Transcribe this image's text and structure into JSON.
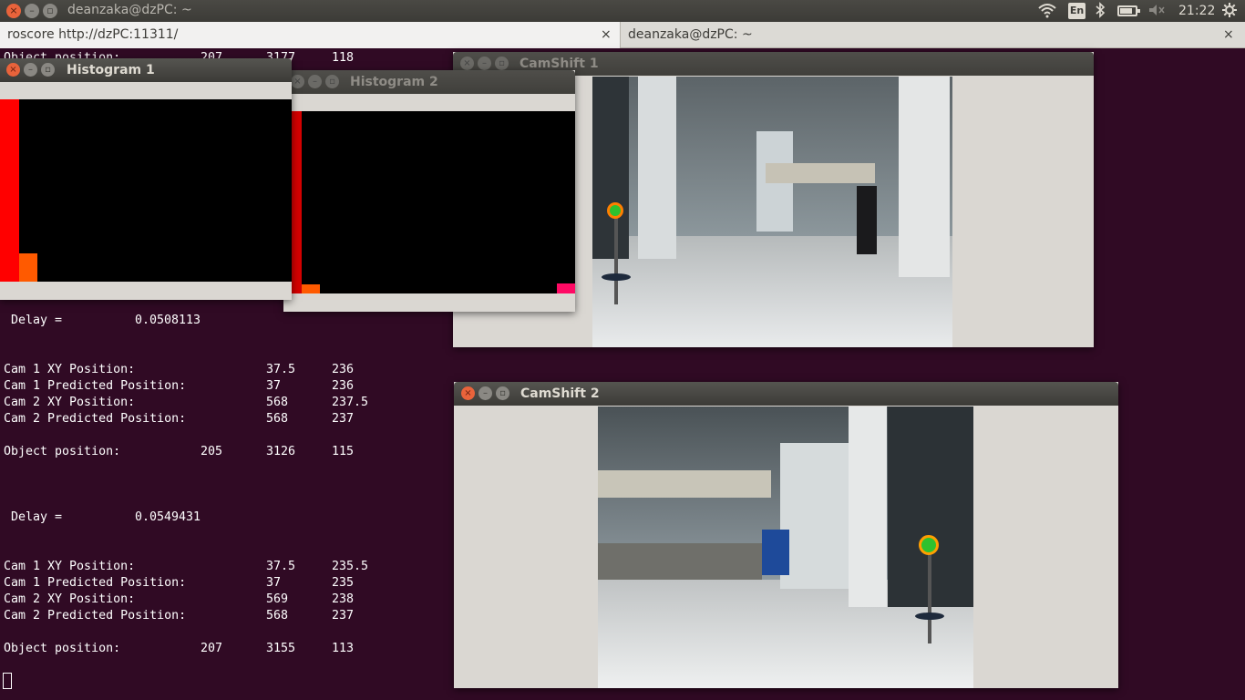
{
  "top_panel": {
    "window_title": "deanzaka@dzPC: ~",
    "lang": "En",
    "clock": "21:22",
    "battery_fraction": 0.8,
    "icons": [
      "wifi-icon",
      "bluetooth-icon",
      "battery-icon",
      "volume-muted-icon",
      "settings-gear-icon"
    ]
  },
  "tabs": [
    {
      "label": "roscore http://dzPC:11311/",
      "close": "×"
    },
    {
      "label": "deanzaka@dzPC: ~",
      "close": "×"
    }
  ],
  "terminal": {
    "partial_top": {
      "label": "Object position:",
      "v1": "207",
      "v2": "3177",
      "v3": "118"
    },
    "block1": {
      "delay_label": " Delay =",
      "delay_value": "0.0508113",
      "rows": [
        {
          "label": "Cam 1 XY Position:",
          "x": "37.5",
          "y": "236"
        },
        {
          "label": "Cam 1 Predicted Position:",
          "x": "37",
          "y": "236"
        },
        {
          "label": "Cam 2 XY Position:",
          "x": "568",
          "y": "237.5"
        },
        {
          "label": "Cam 2 Predicted Position:",
          "x": "568",
          "y": "237"
        }
      ],
      "object": {
        "label": "Object position:",
        "v1": "205",
        "v2": "3126",
        "v3": "115"
      }
    },
    "block2": {
      "delay_label": " Delay =",
      "delay_value": "0.0549431",
      "rows": [
        {
          "label": "Cam 1 XY Position:",
          "x": "37.5",
          "y": "235.5"
        },
        {
          "label": "Cam 1 Predicted Position:",
          "x": "37",
          "y": "235"
        },
        {
          "label": "Cam 2 XY Position:",
          "x": "569",
          "y": "238"
        },
        {
          "label": "Cam 2 Predicted Position:",
          "x": "568",
          "y": "237"
        }
      ],
      "object": {
        "label": "Object position:",
        "v1": "207",
        "v2": "3155",
        "v3": "113"
      }
    }
  },
  "windows": {
    "histogram1": {
      "title": "Histogram 1",
      "bars_colors": [
        "#ff0000",
        "#ff5a00"
      ]
    },
    "histogram2": {
      "title": "Histogram 2",
      "bars_colors": [
        "#d40000",
        "#ff5a00",
        "#ff0a64"
      ]
    },
    "camshift1": {
      "title": "CamShift 1"
    },
    "camshift2": {
      "title": "CamShift 2"
    }
  }
}
